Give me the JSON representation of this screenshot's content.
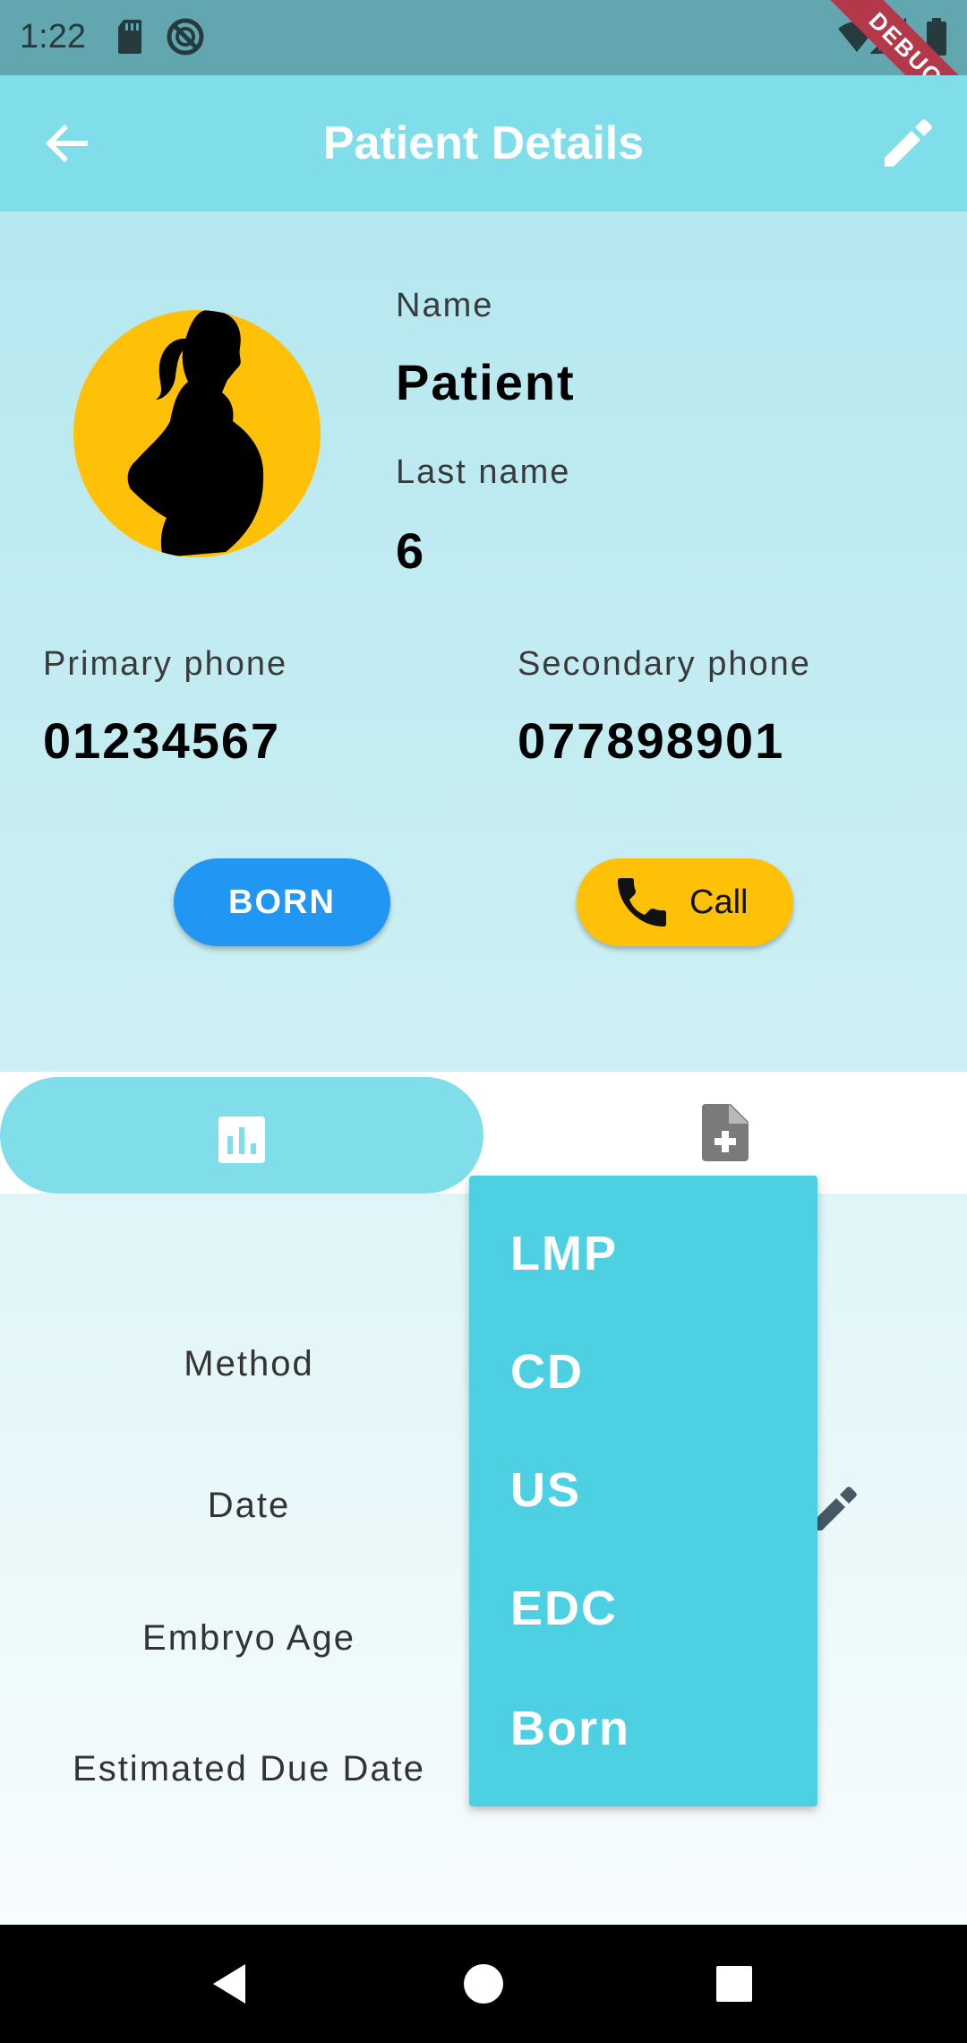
{
  "status_bar": {
    "time": "1:22",
    "icons": [
      "sd-card-icon",
      "do-not-disturb-icon",
      "wifi-icon",
      "signal-icon",
      "battery-icon"
    ],
    "debug_label": "DEBUG"
  },
  "app_bar": {
    "title": "Patient Details",
    "back_icon": "arrow-back-icon",
    "edit_icon": "pencil-icon"
  },
  "patient": {
    "avatar_icon": "pregnant-woman-silhouette-icon",
    "name_label": "Name",
    "name": "Patient",
    "last_name_label": "Last name",
    "last_name": "6",
    "primary_phone_label": "Primary phone",
    "primary_phone": "01234567",
    "secondary_phone_label": "Secondary phone",
    "secondary_phone": "077898901"
  },
  "actions": {
    "born_label": "BORN",
    "call_label": "Call",
    "call_icon": "phone-icon"
  },
  "tabs": [
    {
      "icon": "bar-chart-icon",
      "active": true
    },
    {
      "icon": "add-document-icon",
      "active": false
    }
  ],
  "details": {
    "method_label": "Method",
    "date_label": "Date",
    "embryo_age_label": "Embryo Age",
    "edd_label": "Estimated Due Date"
  },
  "dropdown": {
    "options": [
      "LMP",
      "CD",
      "US",
      "EDC",
      "Born"
    ]
  },
  "colors": {
    "app_bar": "#80deea",
    "status_bar": "#62a7b0",
    "accent_yellow": "#ffc107",
    "accent_blue": "#2196f3",
    "dropdown": "#4dd0e1"
  }
}
